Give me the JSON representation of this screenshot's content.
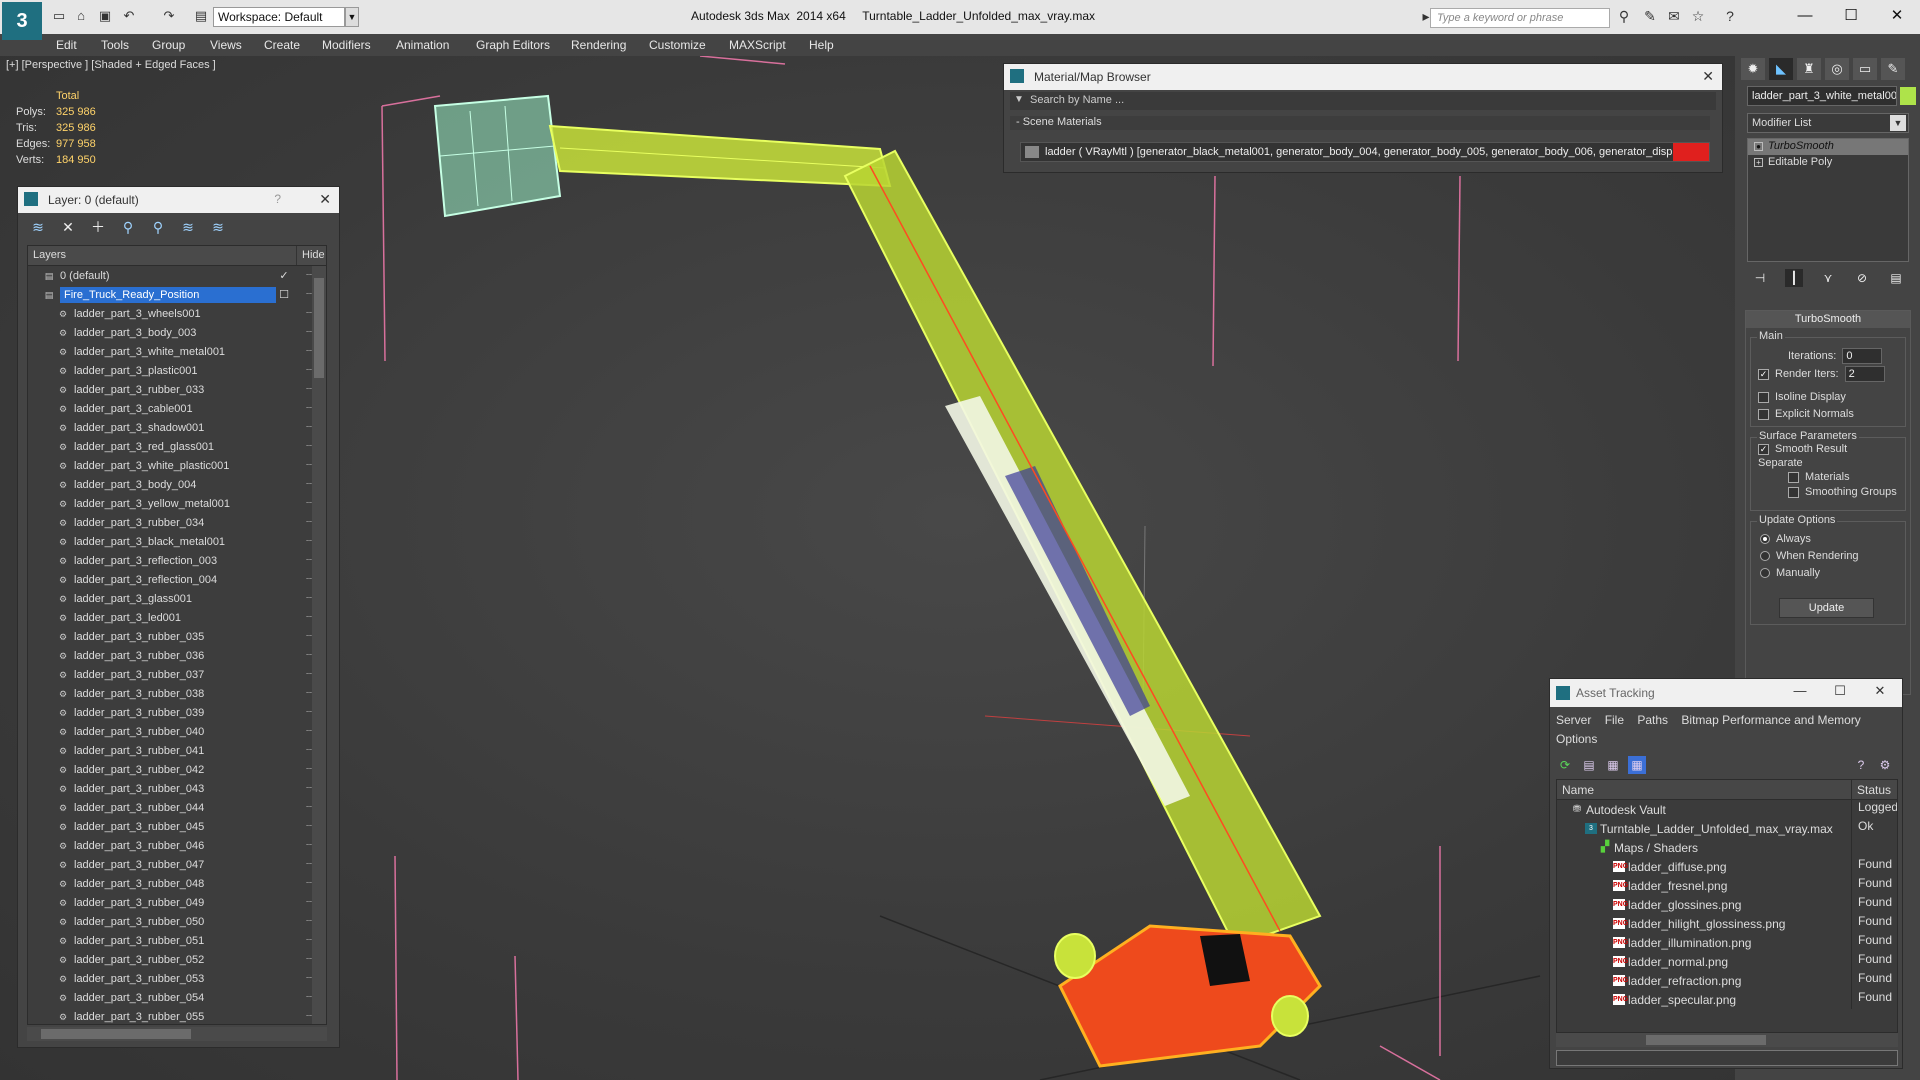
{
  "titlebar": {
    "title": "Autodesk 3ds Max  2014 x64     Turntable_Ladder_Unfolded_max_vray.max",
    "workspace": "Workspace: Default",
    "search_placeholder": "Type a keyword or phrase"
  },
  "menu": [
    "Edit",
    "Tools",
    "Group",
    "Views",
    "Create",
    "Modifiers",
    "Animation",
    "Graph Editors",
    "Rendering",
    "Customize",
    "MAXScript",
    "Help"
  ],
  "viewport": {
    "label": "[+] [Perspective ] [Shaded + Edged Faces ]",
    "stats_title": "Total",
    "stats": [
      {
        "key": "Polys:",
        "value": "325 986"
      },
      {
        "key": "Tris:",
        "value": "325 986"
      },
      {
        "key": "Edges:",
        "value": "977 958"
      },
      {
        "key": "Verts:",
        "value": "184 950"
      }
    ]
  },
  "layer_panel": {
    "title": "Layer: 0 (default)",
    "help": "?",
    "col_layers": "Layers",
    "col_hide": "Hide",
    "rows": [
      {
        "name": "0 (default)",
        "level": 1,
        "check": "✓"
      },
      {
        "name": "Fire_Truck_Ready_Position",
        "level": 1,
        "selected": true,
        "check": "☐"
      },
      {
        "name": "ladder_part_3_wheels001",
        "level": 2
      },
      {
        "name": "ladder_part_3_body_003",
        "level": 2
      },
      {
        "name": "ladder_part_3_white_metal001",
        "level": 2
      },
      {
        "name": "ladder_part_3_plastic001",
        "level": 2
      },
      {
        "name": "ladder_part_3_rubber_033",
        "level": 2
      },
      {
        "name": "ladder_part_3_cable001",
        "level": 2
      },
      {
        "name": "ladder_part_3_shadow001",
        "level": 2
      },
      {
        "name": "ladder_part_3_red_glass001",
        "level": 2
      },
      {
        "name": "ladder_part_3_white_plastic001",
        "level": 2
      },
      {
        "name": "ladder_part_3_body_004",
        "level": 2
      },
      {
        "name": "ladder_part_3_yellow_metal001",
        "level": 2
      },
      {
        "name": "ladder_part_3_rubber_034",
        "level": 2
      },
      {
        "name": "ladder_part_3_black_metal001",
        "level": 2
      },
      {
        "name": "ladder_part_3_reflection_003",
        "level": 2
      },
      {
        "name": "ladder_part_3_reflection_004",
        "level": 2
      },
      {
        "name": "ladder_part_3_glass001",
        "level": 2
      },
      {
        "name": "ladder_part_3_led001",
        "level": 2
      },
      {
        "name": "ladder_part_3_rubber_035",
        "level": 2
      },
      {
        "name": "ladder_part_3_rubber_036",
        "level": 2
      },
      {
        "name": "ladder_part_3_rubber_037",
        "level": 2
      },
      {
        "name": "ladder_part_3_rubber_038",
        "level": 2
      },
      {
        "name": "ladder_part_3_rubber_039",
        "level": 2
      },
      {
        "name": "ladder_part_3_rubber_040",
        "level": 2
      },
      {
        "name": "ladder_part_3_rubber_041",
        "level": 2
      },
      {
        "name": "ladder_part_3_rubber_042",
        "level": 2
      },
      {
        "name": "ladder_part_3_rubber_043",
        "level": 2
      },
      {
        "name": "ladder_part_3_rubber_044",
        "level": 2
      },
      {
        "name": "ladder_part_3_rubber_045",
        "level": 2
      },
      {
        "name": "ladder_part_3_rubber_046",
        "level": 2
      },
      {
        "name": "ladder_part_3_rubber_047",
        "level": 2
      },
      {
        "name": "ladder_part_3_rubber_048",
        "level": 2
      },
      {
        "name": "ladder_part_3_rubber_049",
        "level": 2
      },
      {
        "name": "ladder_part_3_rubber_050",
        "level": 2
      },
      {
        "name": "ladder_part_3_rubber_051",
        "level": 2
      },
      {
        "name": "ladder_part_3_rubber_052",
        "level": 2
      },
      {
        "name": "ladder_part_3_rubber_053",
        "level": 2
      },
      {
        "name": "ladder_part_3_rubber_054",
        "level": 2
      },
      {
        "name": "ladder_part_3_rubber_055",
        "level": 2
      }
    ]
  },
  "material_browser": {
    "title": "Material/Map Browser",
    "search_placeholder": "Search by Name ...",
    "section": "- Scene Materials",
    "material": "ladder  ( VRayMtl ) [generator_black_metal001, generator_body_004, generator_body_005, generator_body_006, generator_disp..."
  },
  "command_panel": {
    "object_name": "ladder_part_3_white_metal001",
    "object_color": "#aee34a",
    "modifier_list": "Modifier List",
    "stack": [
      "TurboSmooth",
      "Editable Poly"
    ],
    "rollout_title": "TurboSmooth",
    "main_group": "Main",
    "iterations_label": "Iterations:",
    "iterations_value": "0",
    "render_iters_label": "Render Iters:",
    "render_iters_value": "2",
    "isoline": "Isoline Display",
    "explicit_normals": "Explicit Normals",
    "surface_group": "Surface Parameters",
    "smooth_result": "Smooth Result",
    "separate": "Separate",
    "materials": "Materials",
    "smoothing_groups": "Smoothing Groups",
    "update_group": "Update Options",
    "always": "Always",
    "when_rendering": "When Rendering",
    "manually": "Manually",
    "update_btn": "Update"
  },
  "asset_tracking": {
    "title": "Asset Tracking",
    "menu": [
      "Server",
      "File",
      "Paths",
      "Bitmap Performance and Memory"
    ],
    "menu2": "Options",
    "col_name": "Name",
    "col_status": "Status",
    "rows": [
      {
        "name": "Autodesk Vault",
        "status": "Logged",
        "indent": 1,
        "icon": "vault"
      },
      {
        "name": "Turntable_Ladder_Unfolded_max_vray.max",
        "status": "Ok",
        "indent": 2,
        "icon": "max"
      },
      {
        "name": "Maps / Shaders",
        "status": "",
        "indent": 3,
        "icon": "maps"
      },
      {
        "name": "ladder_diffuse.png",
        "status": "Found",
        "indent": 4,
        "icon": "png"
      },
      {
        "name": "ladder_fresnel.png",
        "status": "Found",
        "indent": 4,
        "icon": "png"
      },
      {
        "name": "ladder_glossines.png",
        "status": "Found",
        "indent": 4,
        "icon": "png"
      },
      {
        "name": "ladder_hilight_glossiness.png",
        "status": "Found",
        "indent": 4,
        "icon": "png"
      },
      {
        "name": "ladder_illumination.png",
        "status": "Found",
        "indent": 4,
        "icon": "png"
      },
      {
        "name": "ladder_normal.png",
        "status": "Found",
        "indent": 4,
        "icon": "png"
      },
      {
        "name": "ladder_refraction.png",
        "status": "Found",
        "indent": 4,
        "icon": "png"
      },
      {
        "name": "ladder_specular.png",
        "status": "Found",
        "indent": 4,
        "icon": "png"
      }
    ]
  }
}
